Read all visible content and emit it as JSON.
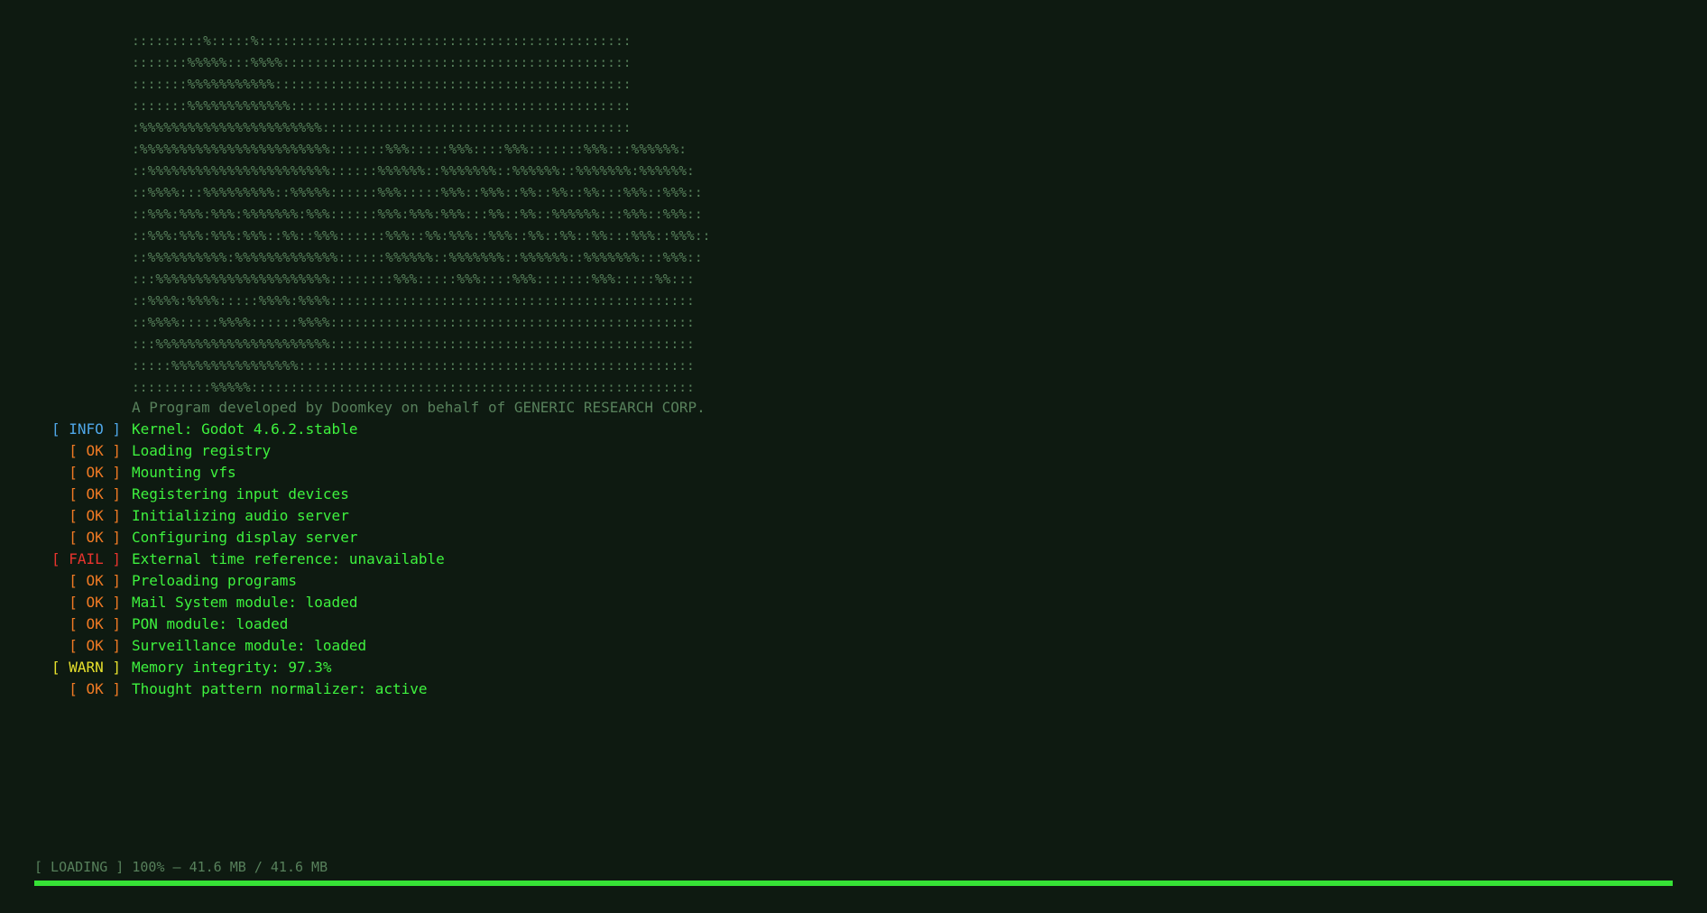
{
  "colors": {
    "background": "#0e1a11",
    "art": "#57805b",
    "message": "#3ef23e",
    "info": "#4fa7e8",
    "ok": "#f07a24",
    "fail": "#e8342e",
    "warn": "#e6e02c",
    "progress": "#36e236"
  },
  "ascii_art": [
    ":::::::::%:::::%:::::::::::::::::::::::::::::::::::::::::::::::",
    ":::::::%%%%%:::%%%%::::::::::::::::::::::::::::::::::::::::::::",
    ":::::::%%%%%%%%%%%:::::::::::::::::::::::::::::::::::::::::::::",
    ":::::::%%%%%%%%%%%%%:::::::::::::::::::::::::::::::::::::::::::",
    ":%%%%%%%%%%%%%%%%%%%%%%%:::::::::::::::::::::::::::::::::::::::",
    ":%%%%%%%%%%%%%%%%%%%%%%%%:::::::%%%:::::%%%::::%%%:::::::%%%:::%%%%%%:",
    "::%%%%%%%%%%%%%%%%%%%%%%%::::::%%%%%%::%%%%%%%::%%%%%%::%%%%%%%:%%%%%%:",
    "::%%%%:::%%%%%%%%%::%%%%%::::::%%%:::::%%%::%%%::%%::%%::%%:::%%%::%%%::",
    "::%%%:%%%:%%%:%%%%%%%:%%%::::::%%%:%%%:%%%:::%%::%%::%%%%%%:::%%%::%%%::",
    "::%%%:%%%:%%%:%%%::%%::%%%::::::%%%::%%:%%%::%%%::%%::%%::%%:::%%%::%%%::",
    "::%%%%%%%%%%:%%%%%%%%%%%%%::::::%%%%%%::%%%%%%%::%%%%%%::%%%%%%%:::%%%::",
    ":::%%%%%%%%%%%%%%%%%%%%%%::::::::%%%:::::%%%::::%%%:::::::%%%:::::%%:::",
    "::%%%%:%%%%:::::%%%%:%%%%::::::::::::::::::::::::::::::::::::::::::::::",
    "::%%%%:::::%%%%::::::%%%%::::::::::::::::::::::::::::::::::::::::::::::",
    ":::%%%%%%%%%%%%%%%%%%%%%%::::::::::::::::::::::::::::::::::::::::::::::",
    ":::::%%%%%%%%%%%%%%%%::::::::::::::::::::::::::::::::::::::::::::::::::",
    "::::::::::%%%%%::::::::::::::::::::::::::::::::::::::::::::::::::::::::"
  ],
  "credits": "A Program developed by Doomkey on behalf of GENERIC RESEARCH CORP.",
  "log": [
    {
      "tag": "[ INFO ]",
      "level": "info",
      "message": "Kernel: Godot 4.6.2.stable"
    },
    {
      "tag": "[ OK ]",
      "level": "ok",
      "message": "Loading registry"
    },
    {
      "tag": "[ OK ]",
      "level": "ok",
      "message": "Mounting vfs"
    },
    {
      "tag": "[ OK ]",
      "level": "ok",
      "message": "Registering input devices"
    },
    {
      "tag": "[ OK ]",
      "level": "ok",
      "message": "Initializing audio server"
    },
    {
      "tag": "[ OK ]",
      "level": "ok",
      "message": "Configuring display server"
    },
    {
      "tag": "[ FAIL ]",
      "level": "fail",
      "message": "External time reference: unavailable"
    },
    {
      "tag": "[ OK ]",
      "level": "ok",
      "message": "Preloading programs"
    },
    {
      "tag": "[ OK ]",
      "level": "ok",
      "message": "Mail System module: loaded"
    },
    {
      "tag": "[ OK ]",
      "level": "ok",
      "message": "PON module: loaded"
    },
    {
      "tag": "[ OK ]",
      "level": "ok",
      "message": "Surveillance module: loaded"
    },
    {
      "tag": "[ WARN ]",
      "level": "warn",
      "message": "Memory integrity: 97.3%"
    },
    {
      "tag": "[ OK ]",
      "level": "ok",
      "message": "Thought pattern normalizer: active"
    }
  ],
  "status": {
    "text": "[ LOADING ] 100% — 41.6 MB / 41.6 MB",
    "progress": 1.0
  }
}
